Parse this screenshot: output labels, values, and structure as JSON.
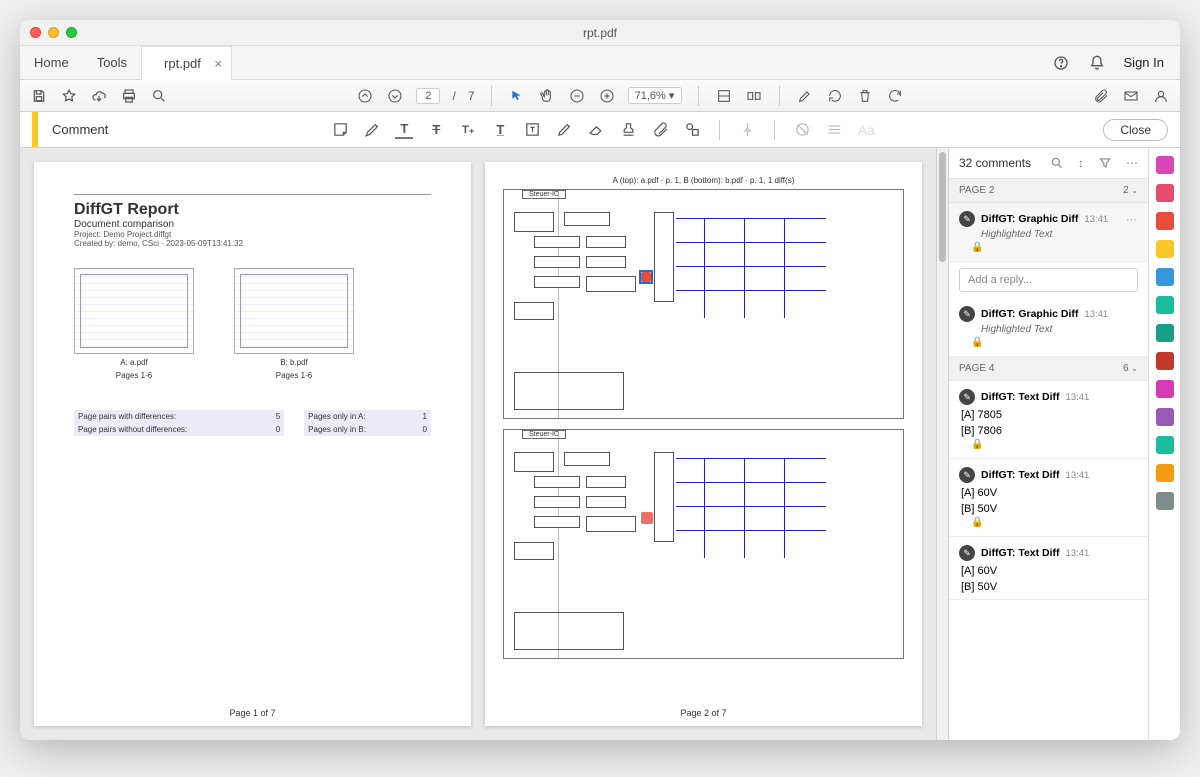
{
  "window": {
    "title": "rpt.pdf"
  },
  "menu": {
    "home": "Home",
    "tools": "Tools",
    "doc_tab": "rpt.pdf",
    "sign_in": "Sign In"
  },
  "toolbar": {
    "page_current": "2",
    "page_sep": "/",
    "page_total": "7",
    "zoom": "71,6%"
  },
  "commentbar": {
    "label": "Comment",
    "close": "Close"
  },
  "pages": {
    "p1": {
      "title": "DiffGT Report",
      "subtitle": "Document comparison",
      "meta1": "Project: Demo Project.diffgt",
      "meta2": "Created by: demo, CSci · 2023-05-09T13:41:32",
      "thumbA_cap": "A: a.pdf",
      "thumbA_pages": "Pages 1-6",
      "thumbB_cap": "B: b.pdf",
      "thumbB_pages": "Pages 1-6",
      "row1a": "Page pairs with differences:",
      "row1b": "5",
      "row1c": "Pages only in A:",
      "row1d": "1",
      "row2a": "Page pairs without differences:",
      "row2b": "0",
      "row2c": "Pages only in B:",
      "row2d": "0",
      "footer": "Page 1 of 7"
    },
    "p2": {
      "header": "A (top): a.pdf · p. 1, B (bottom): b.pdf · p. 1, 1 diff(s)",
      "ic": "Steuer-IC",
      "footer": "Page 2 of 7"
    }
  },
  "comments": {
    "count_label": "32 comments",
    "group1": {
      "label": "PAGE 2",
      "count": "2"
    },
    "c1": {
      "author": "DiffGT: Graphic Diff",
      "time": "13:41",
      "sub": "Highlighted Text"
    },
    "reply_placeholder": "Add a reply...",
    "c2": {
      "author": "DiffGT: Graphic Diff",
      "time": "13:41",
      "sub": "Highlighted Text"
    },
    "group2": {
      "label": "PAGE 4",
      "count": "6"
    },
    "c3": {
      "author": "DiffGT: Text Diff",
      "time": "13:41",
      "lineA": "[A] 7805",
      "lineB": "[B] 7806"
    },
    "c4": {
      "author": "DiffGT: Text Diff",
      "time": "13:41",
      "lineA": "[A] 60V",
      "lineB": "[B] 50V"
    },
    "c5": {
      "author": "DiffGT: Text Diff",
      "time": "13:41",
      "lineA": "[A] 60V",
      "lineB": "[B] 50V"
    }
  }
}
